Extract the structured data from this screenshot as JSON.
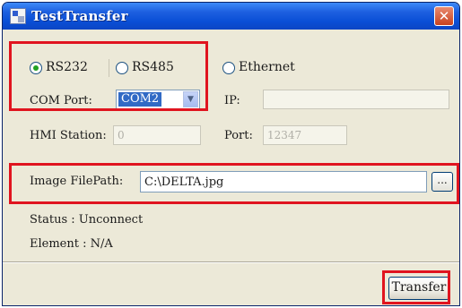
{
  "window": {
    "title": "TestTransfer",
    "close_glyph": "✕"
  },
  "connection": {
    "rs232_label": "RS232",
    "rs485_label": "RS485",
    "ethernet_label": "Ethernet",
    "selected": "RS232"
  },
  "serial": {
    "com_port_label": "COM Port:",
    "com_port_value": "COM2",
    "hmi_station_label": "HMI Station:",
    "hmi_station_value": "0"
  },
  "network": {
    "ip_label": "IP:",
    "ip_value": "",
    "port_label": "Port:",
    "port_value": "12347"
  },
  "image": {
    "path_label": "Image FilePath:",
    "path_value": "C:\\DELTA.jpg",
    "browse_label": "..."
  },
  "status": {
    "status_text": "Status : Unconnect",
    "element_text": "Element : N/A"
  },
  "actions": {
    "transfer_label": "Transfer"
  },
  "colors": {
    "highlight": "#e0141f",
    "titlebar": "#0a4fd6",
    "selection": "#316ac5"
  },
  "icons": {
    "title": "app-window-icon",
    "close": "close-icon",
    "dropdown": "chevron-down-icon"
  }
}
